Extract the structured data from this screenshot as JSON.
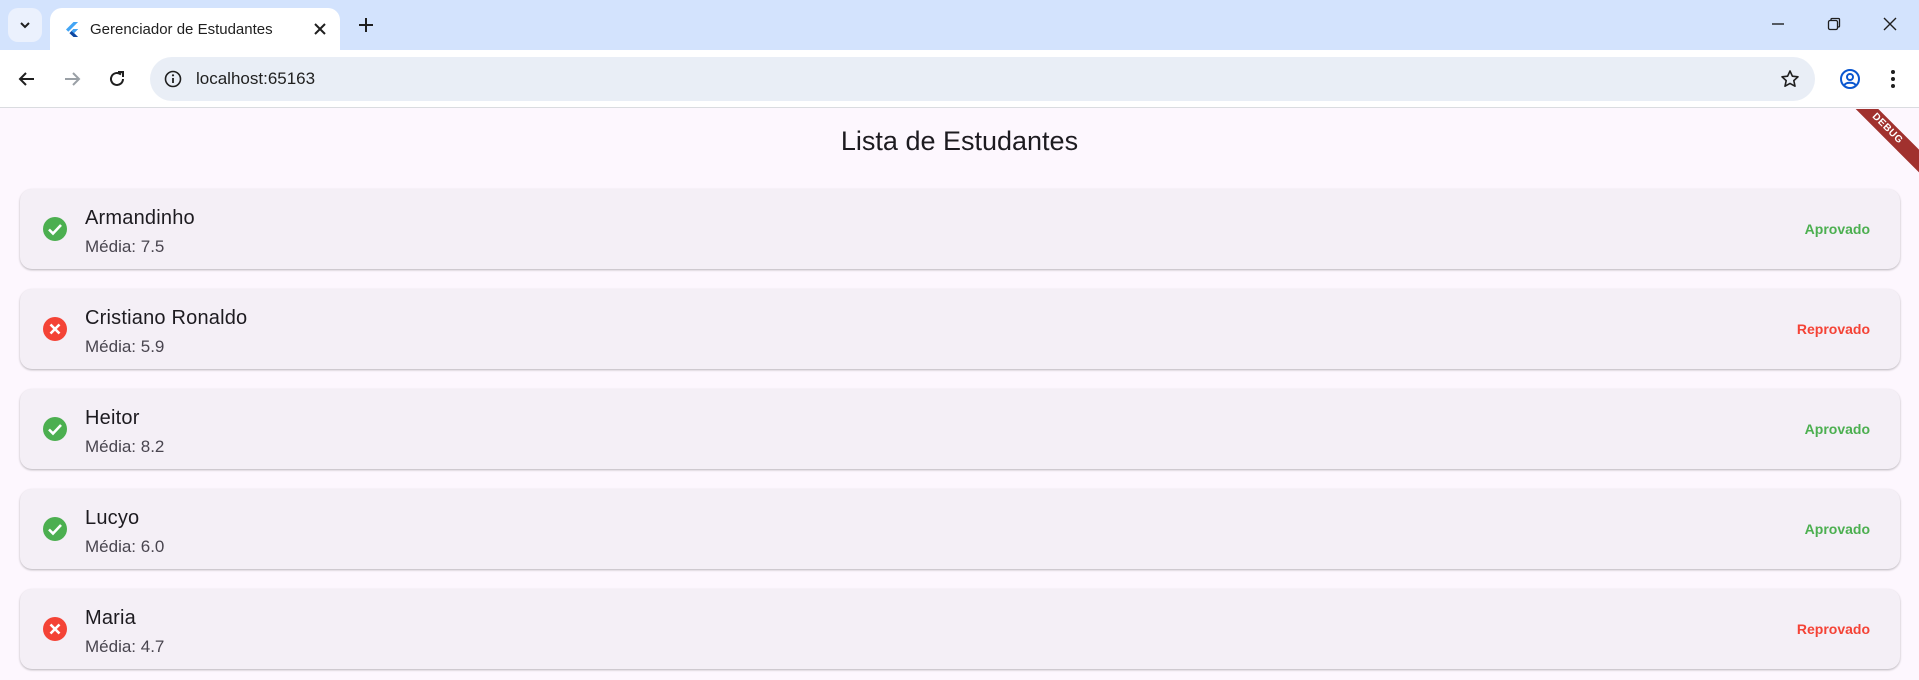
{
  "browser": {
    "tab_title": "Gerenciador de Estudantes",
    "url": "localhost:65163",
    "icons": {
      "tab_search": "chevron-down-icon",
      "favicon": "flutter-icon",
      "tab_close": "close-icon",
      "new_tab": "plus-icon",
      "back": "arrow-left-icon",
      "forward": "arrow-right-icon",
      "reload": "reload-icon",
      "site_info": "info-icon",
      "bookmark": "star-icon",
      "profile": "account-circle-icon",
      "menu": "more-vert-icon",
      "minimize": "minimize-icon",
      "restore": "restore-icon",
      "close_window": "close-icon"
    }
  },
  "app": {
    "title": "Lista de Estudantes",
    "debug_label": "DEBUG",
    "colors": {
      "approved": "#4caf50",
      "failed": "#f44336",
      "background": "#fdf7fe",
      "card": "#f4eff6"
    },
    "students": [
      {
        "name": "Armandinho",
        "media": "Média: 7.5",
        "status": "Aprovado",
        "approved": true
      },
      {
        "name": "Cristiano Ronaldo",
        "media": "Média: 5.9",
        "status": "Reprovado",
        "approved": false
      },
      {
        "name": "Heitor",
        "media": "Média: 8.2",
        "status": "Aprovado",
        "approved": true
      },
      {
        "name": "Lucyo",
        "media": "Média: 6.0",
        "status": "Aprovado",
        "approved": true
      },
      {
        "name": "Maria",
        "media": "Média: 4.7",
        "status": "Reprovado",
        "approved": false
      }
    ]
  }
}
